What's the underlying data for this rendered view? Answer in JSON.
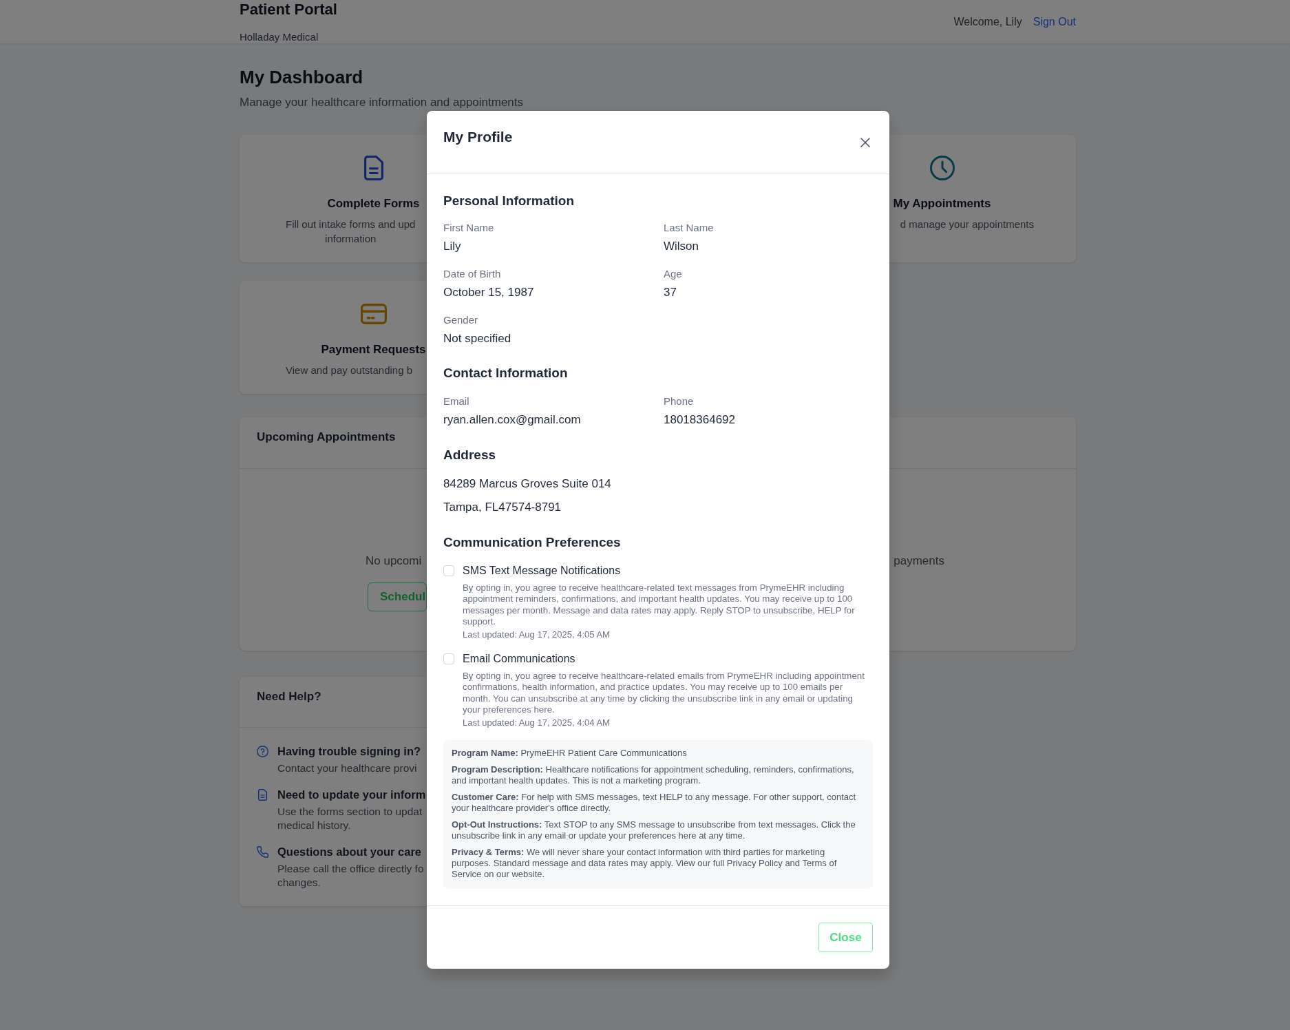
{
  "header": {
    "title": "Patient Portal",
    "subtitle": "Holladay Medical",
    "welcome": "Welcome, Lily",
    "sign_out": "Sign Out"
  },
  "dashboard": {
    "title": "My Dashboard",
    "subtitle": "Manage your healthcare information and appointments",
    "action_cards": [
      {
        "title": "Complete Forms",
        "description": [
          "Fill out intake forms and upd",
          "information"
        ]
      },
      {
        "title": "My Appointments",
        "description": [
          "d manage your appointments"
        ]
      },
      {
        "title": "Payment Requests",
        "description": [
          "View and pay outstanding b"
        ]
      }
    ],
    "appointments": {
      "title": "Upcoming Appointments",
      "empty_text": "No upcomi",
      "button": "Schedul",
      "side_text": "payments"
    },
    "help": {
      "title": "Need Help?",
      "items": [
        {
          "title": "Having trouble signing in?",
          "lines": [
            "Contact your healthcare provi"
          ]
        },
        {
          "title": "Need to update your inform",
          "lines": [
            "Use the forms section to updat",
            "medical history."
          ]
        },
        {
          "title": "Questions about your care",
          "lines": [
            "Please call the office directly fo",
            "changes."
          ]
        }
      ]
    }
  },
  "profile_modal": {
    "title": "My Profile",
    "sections": [
      {
        "kind": "fields",
        "title": "Personal Information",
        "fields": [
          {
            "label": "First Name",
            "value": "Lily"
          },
          {
            "label": "Last Name",
            "value": "Wilson"
          },
          {
            "label": "Date of Birth",
            "value": "October 15, 1987"
          },
          {
            "label": "Age",
            "value": "37"
          },
          {
            "label": "Gender",
            "value": "Not specified"
          }
        ]
      },
      {
        "kind": "fields",
        "title": "Contact Information",
        "fields": [
          {
            "label": "Email",
            "value": "ryan.allen.cox@gmail.com"
          },
          {
            "label": "Phone",
            "value": "18018364692"
          }
        ]
      },
      {
        "kind": "address",
        "title": "Address",
        "lines": [
          "84289 Marcus Groves Suite 014",
          "Tampa, FL47574-8791"
        ]
      },
      {
        "kind": "preferences",
        "title": "Communication Preferences",
        "preferences": [
          {
            "title": "SMS Text Message Notifications",
            "checked": false,
            "description": "By opting in, you agree to receive healthcare-related text messages from PrymeEHR including appointment reminders, confirmations, and important health updates. You may receive up to 100 messages per month. Message and data rates may apply. Reply STOP to unsubscribe, HELP for support.",
            "last_updated": "Last updated: Aug 17, 2025, 4:05 AM"
          },
          {
            "title": "Email Communications",
            "checked": false,
            "description": "By opting in, you agree to receive healthcare-related emails from PrymeEHR including appointment confirmations, health information, and practice updates. You may receive up to 100 emails per month. You can unsubscribe at any time by clicking the unsubscribe link in any email or updating your preferences here.",
            "last_updated": "Last updated: Aug 17, 2025, 4:04 AM"
          }
        ],
        "program_info": [
          "**Program Name:** PrymeEHR Patient Care Communications",
          "**Program Description:** Healthcare notifications for appointment scheduling, reminders, confirmations, and important health updates. This is not a marketing program.",
          "**Customer Care:** For help with SMS messages, text HELP to any message. For other support, contact your healthcare provider's office directly.",
          "**Opt-Out Instructions:** Text STOP to any SMS message to unsubscribe from text messages. Click the unsubscribe link in any email or update your preferences here at any time.",
          "**Privacy & Terms:** We will never share your contact information with third parties for marketing purposes. Standard message and data rates may apply. View our full Privacy Policy and Terms of Service on our website."
        ]
      }
    ],
    "close_button": "Close"
  }
}
